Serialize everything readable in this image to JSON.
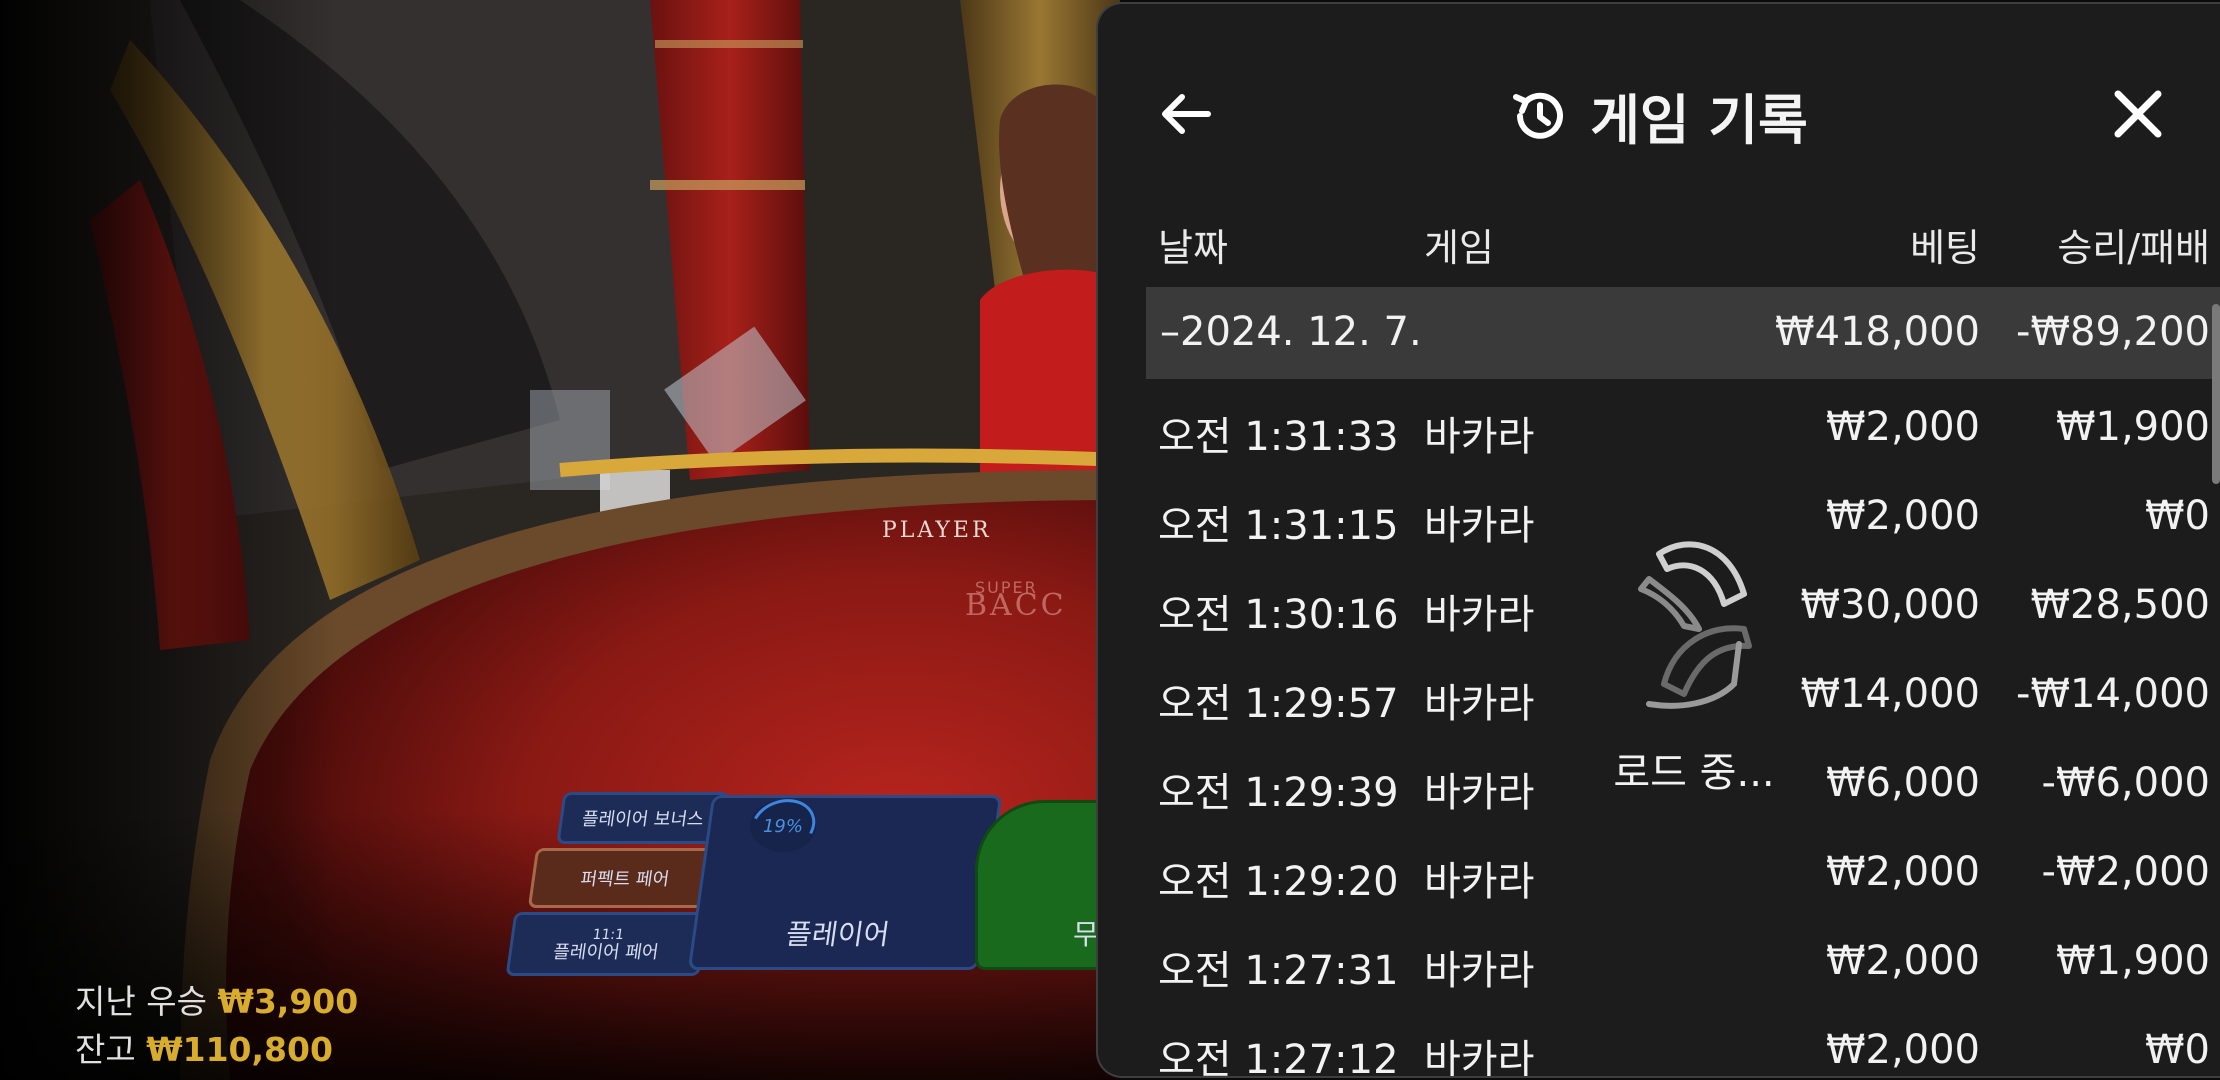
{
  "scene": {
    "table_text": "PLAYER",
    "table_logo_small": "SUPER",
    "table_logo_big": "BACC",
    "bet_spots": {
      "player_bonus": "플레이어 보너스",
      "perfect_pair": "퍼펙트 페어",
      "player_pair_odds": "11:1",
      "player_pair": "플레이어 페어",
      "player": "플레이어",
      "tie": "무"
    },
    "player_percent": "19%",
    "stats": {
      "last_win_label": "지난 우승",
      "last_win_value": "₩3,900",
      "balance_label": "잔고",
      "balance_value": "₩110,800"
    }
  },
  "panel": {
    "title": "게임 기록",
    "icons": {
      "back": "arrow-left-icon",
      "history": "history-icon",
      "close": "close-icon",
      "loading": "spinner-icon"
    },
    "columns": {
      "date": "날짜",
      "game": "게임",
      "bet": "베팅",
      "win_loss": "승리/패배"
    },
    "summary": {
      "date": "–2024. 12. 7.",
      "bet": "₩418,000",
      "win_loss": "-₩89,200"
    },
    "rows": [
      {
        "time": "오전 1:31:33",
        "game": "바카라",
        "bet": "₩2,000",
        "win_loss": "₩1,900"
      },
      {
        "time": "오전 1:31:15",
        "game": "바카라",
        "bet": "₩2,000",
        "win_loss": "₩0"
      },
      {
        "time": "오전 1:30:16",
        "game": "바카라",
        "bet": "₩30,000",
        "win_loss": "₩28,500"
      },
      {
        "time": "오전 1:29:57",
        "game": "바카라",
        "bet": "₩14,000",
        "win_loss": "-₩14,000"
      },
      {
        "time": "오전 1:29:39",
        "game": "바카라",
        "bet": "₩6,000",
        "win_loss": "-₩6,000"
      },
      {
        "time": "오전 1:29:20",
        "game": "바카라",
        "bet": "₩2,000",
        "win_loss": "-₩2,000"
      },
      {
        "time": "오전 1:27:31",
        "game": "바카라",
        "bet": "₩2,000",
        "win_loss": "₩1,900"
      },
      {
        "time": "오전 1:27:12",
        "game": "바카라",
        "bet": "₩2,000",
        "win_loss": "₩0"
      }
    ],
    "loading_text": "로드 중..."
  }
}
